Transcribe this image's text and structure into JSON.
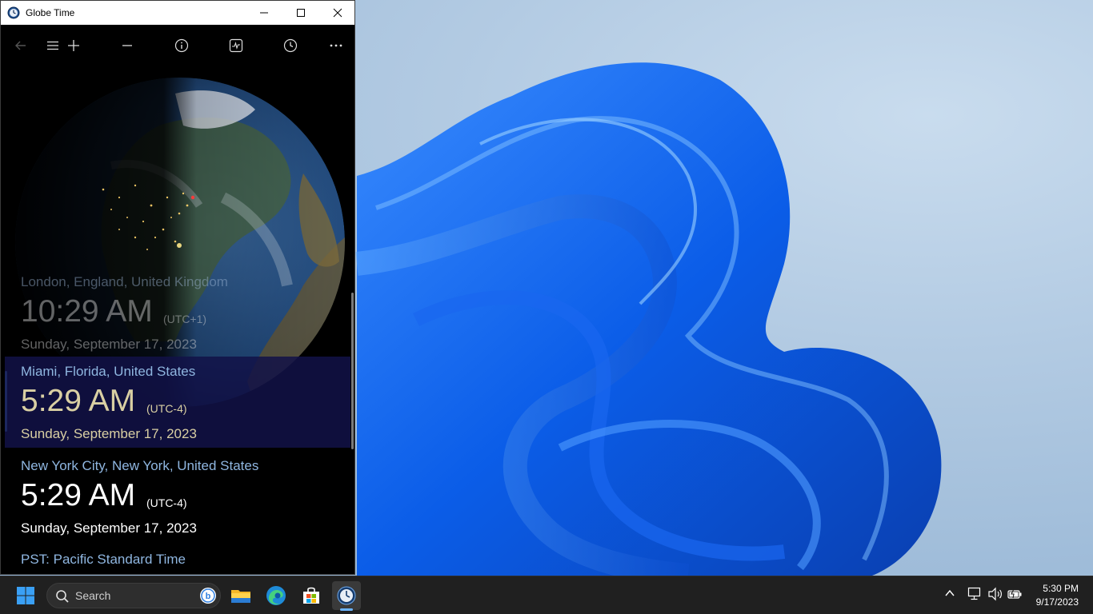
{
  "window": {
    "title": "Globe Time"
  },
  "toolbar": {
    "icons": [
      "back-arrow-icon",
      "hamburger-menu-icon",
      "add-icon",
      "minus-icon",
      "info-icon",
      "pulse-chart-icon",
      "clock-history-icon",
      "more-ellipsis-icon"
    ]
  },
  "locations": [
    {
      "city": "London, England, United Kingdom",
      "time": "10:29 AM",
      "offset": "(UTC+1)",
      "date": "Sunday, September 17, 2023"
    },
    {
      "city": "Miami, Florida, United States",
      "time": "5:29 AM",
      "offset": "(UTC-4)",
      "date": "Sunday, September 17, 2023"
    },
    {
      "city": "New York City, New York, United States",
      "time": "5:29 AM",
      "offset": "(UTC-4)",
      "date": "Sunday, September 17, 2023"
    }
  ],
  "partial_entry": "PST: Pacific Standard Time",
  "selected_index": 1,
  "taskbar": {
    "search_label": "Search",
    "pinned": [
      "windows-start-icon",
      "file-explorer-icon",
      "edge-browser-icon",
      "microsoft-store-icon",
      "globe-time-app-icon"
    ],
    "clock_time": "5:30 PM",
    "clock_date": "9/17/2023"
  },
  "colors": {
    "accent": "#5aa0e6",
    "city_text": "#8fb6e0",
    "selected_bg": "#121248",
    "selected_text": "#d9cfa3",
    "taskbar_bg": "#202020"
  }
}
